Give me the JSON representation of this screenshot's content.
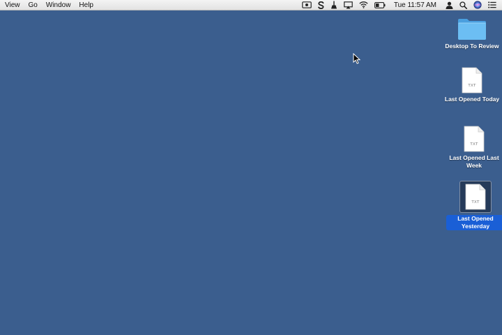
{
  "menubar": {
    "menus": [
      "View",
      "Go",
      "Window",
      "Help"
    ],
    "status_icons": [
      "screen-record-icon",
      "skype-icon",
      "cleanup-broom-icon",
      "airplay-icon",
      "wifi-icon",
      "battery-icon"
    ],
    "clock": "Tue 11:57 AM",
    "right_icons": [
      "user-icon",
      "spotlight-search-icon",
      "siri-icon",
      "notification-center-icon"
    ]
  },
  "desktop": {
    "background_color": "#3b5e8e",
    "icons": [
      {
        "label": "Desktop To Review",
        "kind": "folder",
        "selected": false
      },
      {
        "label": "Last Opened Today",
        "kind": "txt",
        "badge": "TXT",
        "selected": false
      },
      {
        "label": "Last Opened Last Week",
        "kind": "txt",
        "badge": "TXT",
        "selected": false
      },
      {
        "label": "Last Opened Yesterday",
        "kind": "txt",
        "badge": "TXT",
        "selected": true
      }
    ]
  },
  "colors": {
    "selection_label": "#1a5fd6",
    "folder_blue": "#62b6ef"
  }
}
